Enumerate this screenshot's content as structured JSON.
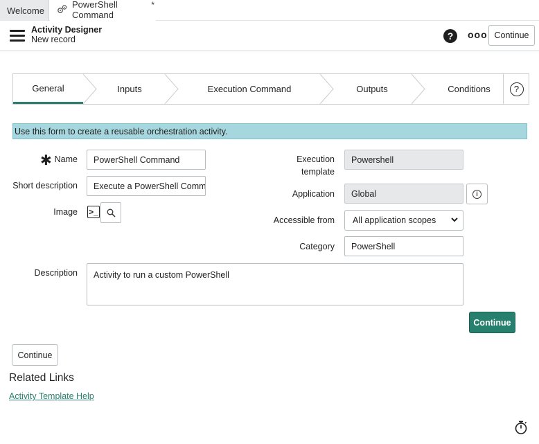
{
  "tabs": [
    {
      "label": "Welcome"
    },
    {
      "label": "PowerShell Command",
      "modified_mark": "*",
      "icon": "gears-icon"
    }
  ],
  "header": {
    "title": "Activity Designer",
    "subtitle": "New record",
    "continue_label": "Continue",
    "help_icon": "question-circle-icon",
    "more_icon": "more-options-icon"
  },
  "steps": [
    {
      "label": "General",
      "active": true
    },
    {
      "label": "Inputs",
      "active": false
    },
    {
      "label": "Execution Command",
      "active": false
    },
    {
      "label": "Outputs",
      "active": false
    },
    {
      "label": "Conditions",
      "active": false
    }
  ],
  "steps_help": "?",
  "banner": "Use this form to create a reusable orchestration activity.",
  "form": {
    "name_label": "Name",
    "name_value": "PowerShell Command",
    "required_mark": "✱",
    "short_desc_label": "Short description",
    "short_desc_value": "Execute a PowerShell Comma",
    "image_label": "Image",
    "image_glyph": ">_",
    "description_label": "Description",
    "description_value": "Activity to run a custom PowerShell",
    "exec_template_label_1": "Execution",
    "exec_template_label_2": "template",
    "exec_template_value": "Powershell",
    "application_label": "Application",
    "application_value": "Global",
    "accessible_label": "Accessible from",
    "accessible_value": "All application scopes",
    "category_label": "Category",
    "category_value": "PowerShell"
  },
  "buttons": {
    "continue_primary": "Continue",
    "continue_secondary": "Continue"
  },
  "related": {
    "title": "Related Links",
    "link": "Activity Template Help"
  },
  "colors": {
    "primary": "#26806d",
    "banner": "#a6d6de",
    "active_step": "#2e7d6c",
    "link": "#2a7f6e"
  }
}
